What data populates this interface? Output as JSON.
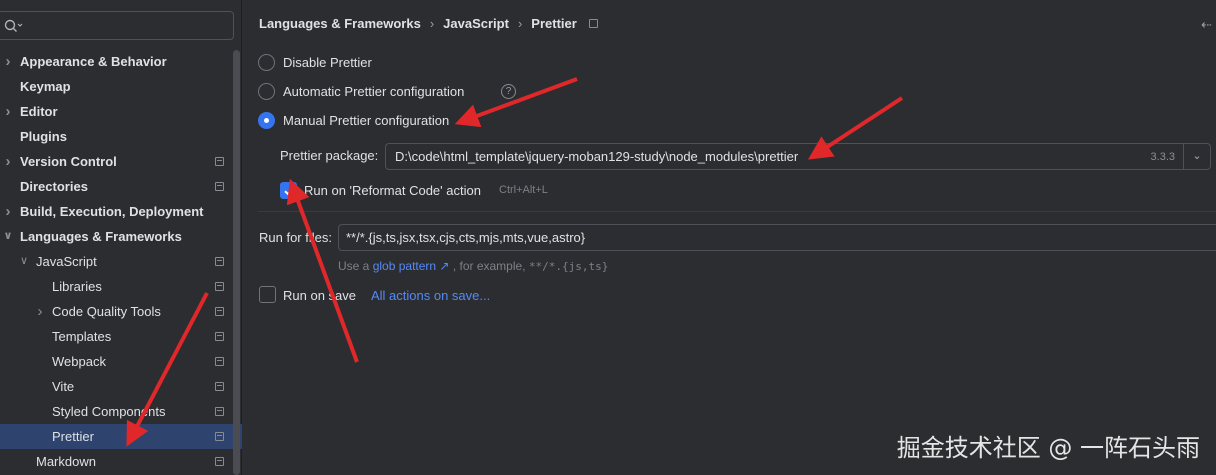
{
  "sidebar": {
    "search": {
      "value": ""
    },
    "items": [
      {
        "label": "Appearance & Behavior",
        "level": 0,
        "chevron": "right",
        "bold": true,
        "project": false
      },
      {
        "label": "Keymap",
        "level": 0,
        "chevron": "",
        "bold": true,
        "project": false
      },
      {
        "label": "Editor",
        "level": 0,
        "chevron": "right",
        "bold": true,
        "project": false
      },
      {
        "label": "Plugins",
        "level": 0,
        "chevron": "",
        "bold": true,
        "project": false
      },
      {
        "label": "Version Control",
        "level": 0,
        "chevron": "right",
        "bold": true,
        "project": true
      },
      {
        "label": "Directories",
        "level": 0,
        "chevron": "",
        "bold": true,
        "project": true
      },
      {
        "label": "Build, Execution, Deployment",
        "level": 0,
        "chevron": "right",
        "bold": true,
        "project": false
      },
      {
        "label": "Languages & Frameworks",
        "level": 0,
        "chevron": "down",
        "bold": true,
        "project": false
      },
      {
        "label": "JavaScript",
        "level": 1,
        "chevron": "down",
        "bold": false,
        "project": true
      },
      {
        "label": "Libraries",
        "level": 2,
        "chevron": "",
        "bold": false,
        "project": true
      },
      {
        "label": "Code Quality Tools",
        "level": 2,
        "chevron": "right",
        "bold": false,
        "project": true
      },
      {
        "label": "Templates",
        "level": 2,
        "chevron": "",
        "bold": false,
        "project": true
      },
      {
        "label": "Webpack",
        "level": 2,
        "chevron": "",
        "bold": false,
        "project": true
      },
      {
        "label": "Vite",
        "level": 2,
        "chevron": "",
        "bold": false,
        "project": true
      },
      {
        "label": "Styled Components",
        "level": 2,
        "chevron": "",
        "bold": false,
        "project": true
      },
      {
        "label": "Prettier",
        "level": 2,
        "chevron": "",
        "bold": false,
        "project": true,
        "selected": true
      },
      {
        "label": "Markdown",
        "level": 1,
        "chevron": "",
        "bold": false,
        "project": true
      }
    ]
  },
  "breadcrumb": {
    "items": [
      "Languages & Frameworks",
      "JavaScript",
      "Prettier"
    ],
    "separator": "›"
  },
  "options": {
    "disable": "Disable Prettier",
    "automatic": "Automatic Prettier configuration",
    "manual": "Manual Prettier configuration",
    "selected": "manual"
  },
  "package": {
    "label": "Prettier package:",
    "value": "D:\\code\\html_template\\jquery-moban129-study\\node_modules\\prettier",
    "version": "3.3.3"
  },
  "reformat": {
    "label": "Run on 'Reformat Code' action",
    "checked": true,
    "shortcut": "Ctrl+Alt+L"
  },
  "run_for_files": {
    "label": "Run for files:",
    "value": "**/*.{js,ts,jsx,tsx,cjs,cts,mjs,mts,vue,astro}",
    "hint_prefix": "Use a",
    "hint_link": "glob pattern ↗",
    "hint_middle": ", for example,",
    "hint_example": "**/*.{js,ts}"
  },
  "run_on_save": {
    "label": "Run on save",
    "checked": false,
    "link": "All actions on save..."
  },
  "watermark": "掘金技术社区 @ 一阵石头雨",
  "colors": {
    "accent": "#3574f0",
    "link": "#548af7",
    "arrow": "#e0282a",
    "background": "#2b2d30",
    "selected_row": "#2e436e"
  },
  "icons": [
    "search-icon",
    "chevron-right-icon",
    "chevron-down-icon",
    "project-scope-icon",
    "help-icon",
    "dropdown-icon",
    "back-arrow-icon",
    "external-link-icon"
  ]
}
